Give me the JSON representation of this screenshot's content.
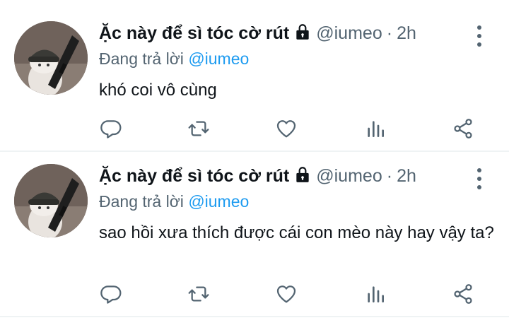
{
  "tweets": [
    {
      "display_name": "Ặc này để sì tóc cờ rút",
      "handle": "@iumeo",
      "separator": "·",
      "time": "2h",
      "reply_prefix": "Đang trả lời",
      "reply_to": "@iumeo",
      "text": "khó coi vô cùng"
    },
    {
      "display_name": "Ặc này để sì tóc cờ rút",
      "handle": "@iumeo",
      "separator": "·",
      "time": "2h",
      "reply_prefix": "Đang trả lời",
      "reply_to": "@iumeo",
      "text": "sao hồi xưa thích được cái con mèo này hay vậy ta?"
    }
  ],
  "icons": {
    "lock": "lock-icon",
    "more": "more-vertical-icon",
    "reply": "reply-icon",
    "retweet": "retweet-icon",
    "like": "heart-icon",
    "views": "views-icon",
    "share": "share-icon"
  },
  "colors": {
    "link": "#1d9bf0",
    "secondary_text": "#536471",
    "primary_text": "#0f1419",
    "divider": "#eff3f4"
  }
}
